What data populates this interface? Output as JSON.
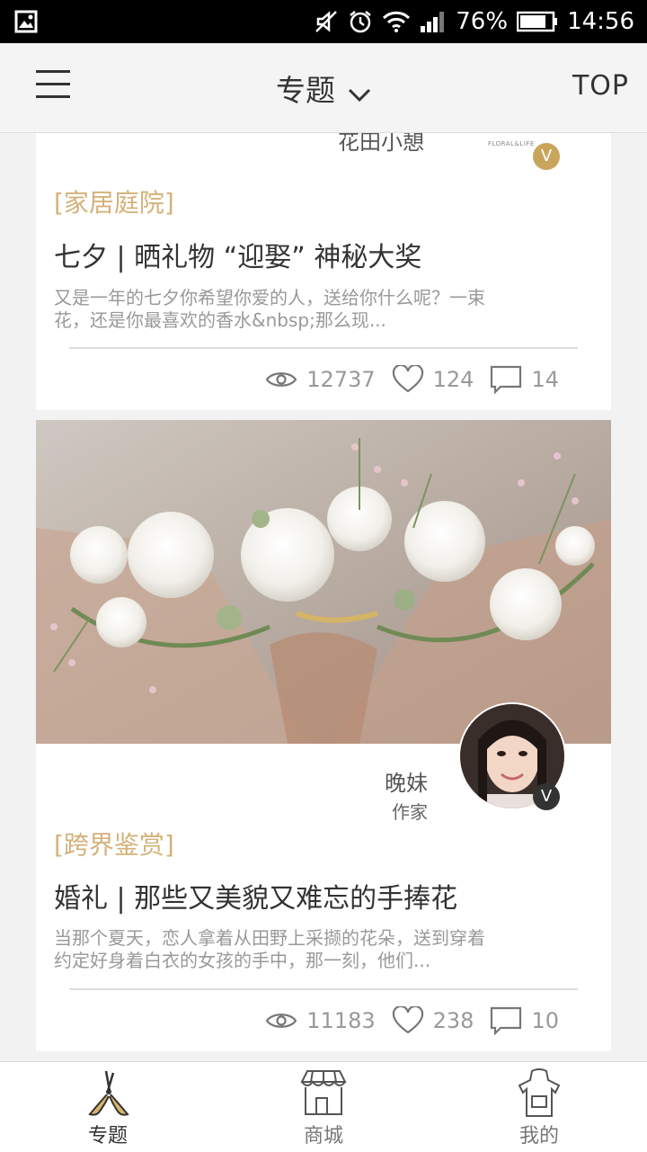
{
  "status_bar": {
    "battery": "76%",
    "time": "14:56"
  },
  "nav": {
    "title": "专题",
    "top_label": "TOP"
  },
  "colors": {
    "accent_gold": "#d3b27a",
    "text_dark": "#333333",
    "text_muted": "#999999"
  },
  "articles": [
    {
      "author_name": "花田小憩",
      "logo_text": "FLORAL&LIFE",
      "badge": "V",
      "tag": "[家居庭院]",
      "title": "七夕 | 晒礼物 “迎娶” 神秘大奖",
      "excerpt_line1": "又是一年的七夕你希望你爱的人，送给你什么呢？一束",
      "excerpt_line2": "花，还是你最喜欢的香水&nbsp;那么现...",
      "views": "12737",
      "likes": "124",
      "comments": "14"
    },
    {
      "author_name": "晚妹",
      "author_role": "作家",
      "badge": "V",
      "tag": "[跨界鉴赏]",
      "title": "婚礼 | 那些又美貌又难忘的手捧花",
      "excerpt_line1": "当那个夏天，恋人拿着从田野上采撷的花朵，送到穿着",
      "excerpt_line2": "约定好身着白衣的女孩的手中，那一刻，他们...",
      "views": "11183",
      "likes": "238",
      "comments": "10"
    }
  ],
  "tabbar": {
    "items": [
      {
        "label": "专题",
        "icon": "pruning-shears-icon"
      },
      {
        "label": "商城",
        "icon": "storefront-icon"
      },
      {
        "label": "我的",
        "icon": "apron-icon"
      }
    ]
  }
}
